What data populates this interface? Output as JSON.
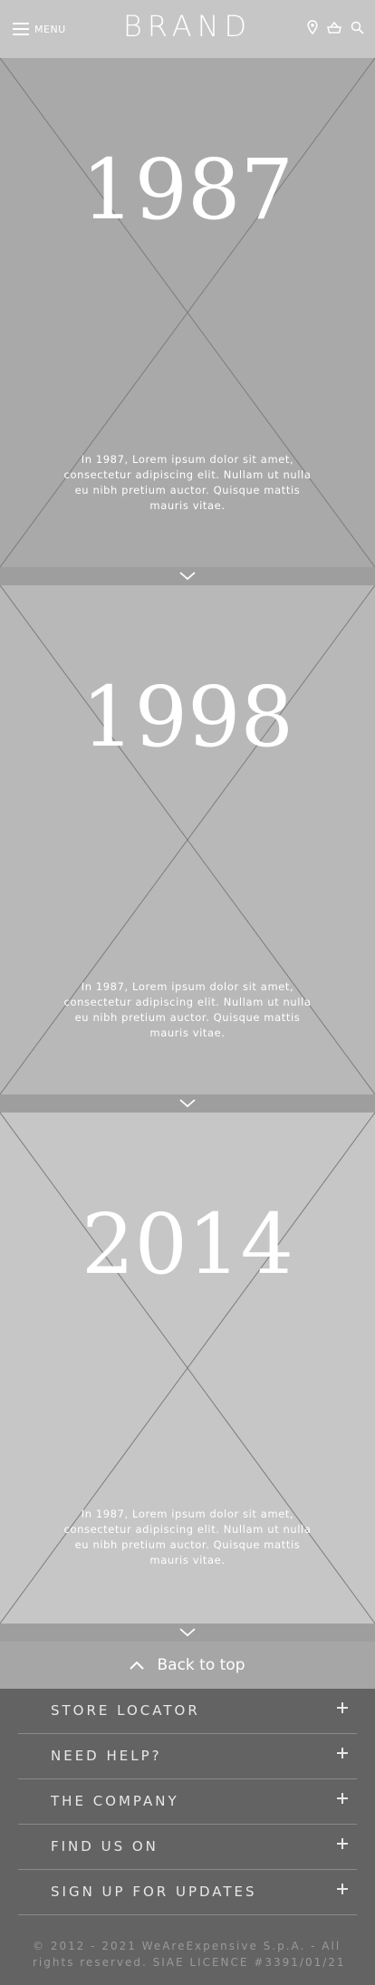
{
  "header": {
    "menu_label": "MENU",
    "brand": "BRAND",
    "icons": [
      "hamburger-icon",
      "location-pin-icon",
      "basket-icon",
      "search-icon"
    ]
  },
  "timeline": [
    {
      "year": "1987",
      "text": "In 1987, Lorem ipsum dolor sit amet, consectetur adipiscing elit. Nullam ut nulla eu nibh pretium auctor. Quisque mattis mauris vitae.",
      "bg": "#a9a9a9"
    },
    {
      "year": "1998",
      "text": "In 1987, Lorem ipsum dolor sit amet, consectetur adipiscing elit. Nullam ut nulla eu nibh pretium auctor. Quisque mattis mauris vitae.",
      "bg": "#b8b8b8"
    },
    {
      "year": "2014",
      "text": "In 1987, Lorem ipsum dolor sit amet, consectetur adipiscing elit. Nullam ut nulla eu nibh pretium auctor. Quisque mattis mauris vitae.",
      "bg": "#c6c6c6"
    }
  ],
  "back_to_top": {
    "label": "Back to top"
  },
  "footer": {
    "items": [
      {
        "label": "STORE LOCATOR"
      },
      {
        "label": "NEED HELP?"
      },
      {
        "label": "THE COMPANY"
      },
      {
        "label": "FIND US ON"
      },
      {
        "label": "SIGN UP FOR UPDATES"
      }
    ],
    "copyright": "© 2012 - 2021 WeAreExpensive S.p.A. - All rights reserved. SIAE LICENCE #3391/01/21"
  },
  "colors": {
    "chevron_bar": "#9e9e9e",
    "back_to_top_bg": "#a6a6a6",
    "footer_bg": "#636363"
  }
}
